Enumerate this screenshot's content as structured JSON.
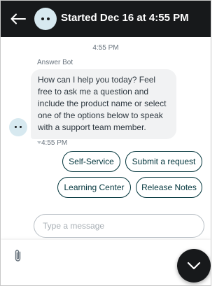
{
  "header": {
    "title": "Started Dec 16 at 4:55 PM",
    "back_icon": "arrow-left-icon",
    "avatar_icon": "bot-face-icon",
    "background": "#17191b"
  },
  "conversation": {
    "top_timestamp": "4:55 PM",
    "sender_name": "Answer Bot",
    "message_text": "How can I help you today? Feel free to ask me a question and include the product name or select one of the options below to speak with a support team member.",
    "message_time": "4:55 PM",
    "bubble_color": "#f1f2f3"
  },
  "options": [
    {
      "label": "Self-Service"
    },
    {
      "label": "Submit a request"
    },
    {
      "label": "Learning Center"
    },
    {
      "label": "Release Notes"
    }
  ],
  "composer": {
    "placeholder": "Type a message",
    "value": "",
    "attach_icon": "paperclip-icon"
  },
  "scroll_button": {
    "icon": "chevron-down-icon"
  },
  "accent_color": "#03363d"
}
